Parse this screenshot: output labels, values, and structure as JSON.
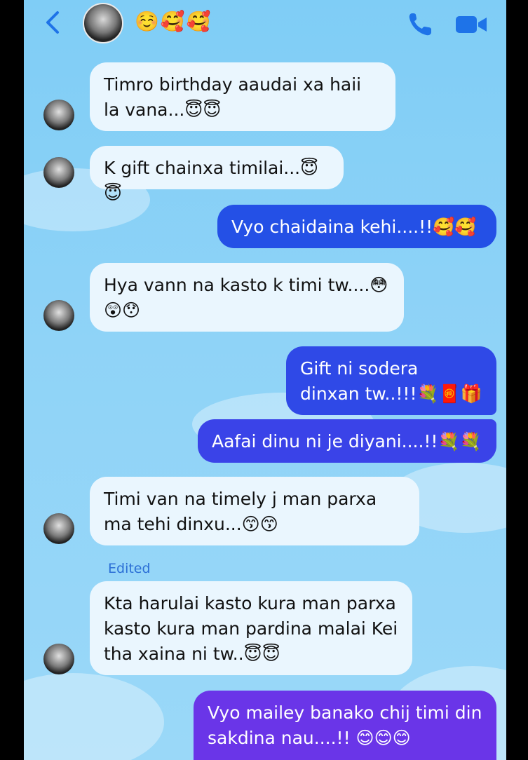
{
  "header": {
    "emojis": "☺️🥰🥰",
    "back_icon": "chevron-left-icon",
    "call_icon": "phone-icon",
    "video_icon": "video-camera-icon",
    "accent_color": "#1e73e8"
  },
  "messages": [
    {
      "dir": "in",
      "text": "Timro birthday aaudai xa haii la vana...😇😇"
    },
    {
      "dir": "in",
      "text": "K gift chainxa timilai...😇😇"
    },
    {
      "dir": "out",
      "text": "Vyo chaidaina kehi....!!🥰🥰"
    },
    {
      "dir": "in",
      "text": "Hya vann na kasto k timi tw....😳 😲😯"
    },
    {
      "dir": "out",
      "text": "Gift ni sodera dinxan tw..!!!💐🧧🎁"
    },
    {
      "dir": "out",
      "text": "Aafai dinu ni je diyani....!!💐💐"
    },
    {
      "dir": "in",
      "text": "Timi van na timely j man parxa ma tehi dinxu...😙😙"
    },
    {
      "dir": "in",
      "text": "Kta harulai kasto kura man parxa kasto kura man pardina malai Kei tha xaina ni tw..😇😇"
    },
    {
      "dir": "out",
      "text": "Vyo mailey banako chij timi din sakdina nau....!! 😊😊😊"
    }
  ],
  "edited_label": "Edited",
  "colors": {
    "incoming": "#eaf6fe",
    "outgoing_top": "#2450e6",
    "outgoing_mid": "#3446e8",
    "outgoing_bottom": "#6a35e8"
  }
}
